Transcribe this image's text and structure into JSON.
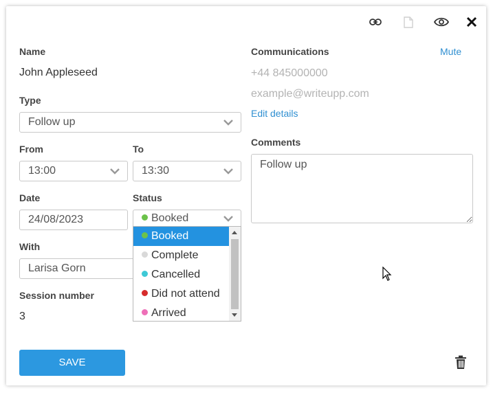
{
  "form": {
    "name_label": "Name",
    "name_value": "John Appleseed",
    "type_label": "Type",
    "type_value": "Follow up",
    "from_label": "From",
    "from_value": "13:00",
    "to_label": "To",
    "to_value": "13:30",
    "date_label": "Date",
    "date_value": "24/08/2023",
    "status_label": "Status",
    "status_value": "Booked",
    "with_label": "With",
    "with_value": "Larisa Gorn",
    "session_label": "Session number",
    "session_value": "3"
  },
  "status_options": [
    {
      "label": "Booked",
      "color": "#6cc24a",
      "selected": true
    },
    {
      "label": "Complete",
      "color": "#d9d9d9",
      "selected": false
    },
    {
      "label": "Cancelled",
      "color": "#3ec9d6",
      "selected": false
    },
    {
      "label": "Did not attend",
      "color": "#d62b2b",
      "selected": false
    },
    {
      "label": "Arrived",
      "color": "#ee6fb8",
      "selected": false
    }
  ],
  "communications": {
    "label": "Communications",
    "mute_label": "Mute",
    "phone": "+44 845000000",
    "email": "example@writeupp.com",
    "edit_label": "Edit details"
  },
  "comments": {
    "label": "Comments",
    "value": "Follow up"
  },
  "actions": {
    "save_label": "SAVE"
  },
  "toolbar": {
    "icons": [
      "link-icon",
      "document-icon",
      "eye-icon",
      "close-icon"
    ]
  },
  "colors": {
    "accent": "#2c98e0",
    "link": "#2f8fd1",
    "selected_option": "#2392e0"
  }
}
